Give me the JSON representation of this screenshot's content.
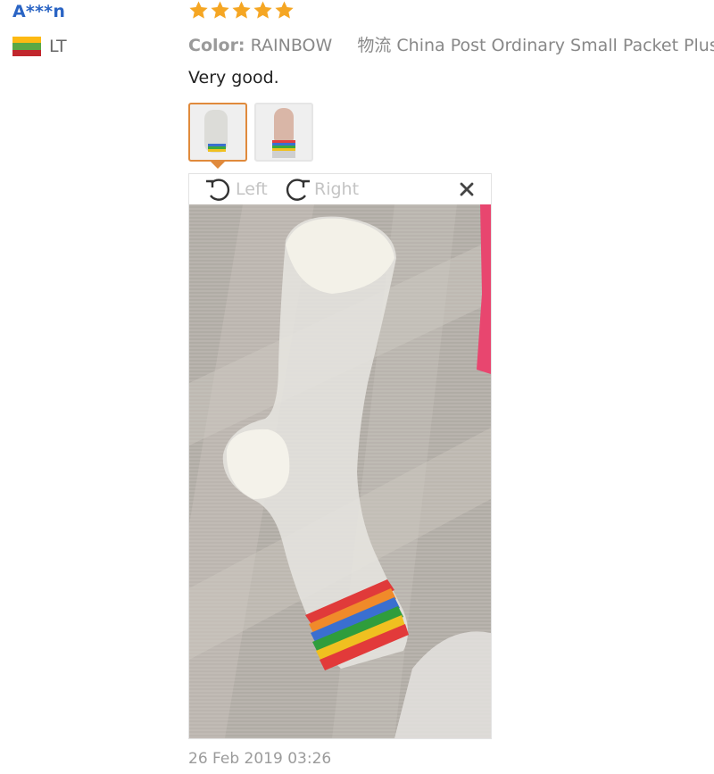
{
  "user": {
    "name": "A***n",
    "country_code": "LT",
    "flag_icon": "lithuania-flag-icon"
  },
  "review": {
    "rating": 5,
    "rating_max": 5,
    "star_color": "#f5a623",
    "color_label": "Color:",
    "color_value": "RAINBOW",
    "logistics_label": "物流",
    "logistics_value": "China Post Ordinary Small Packet Plus",
    "text": "Very good.",
    "date": "26 Feb 2019 03:26"
  },
  "viewer": {
    "rotate_left_label": "Left",
    "rotate_right_label": "Right",
    "rotate_left_icon": "rotate-left-icon",
    "rotate_right_icon": "rotate-right-icon",
    "close_icon": "close-icon",
    "selected_image": 1,
    "image_count": 2
  },
  "colors": {
    "username": "#2a64c4",
    "active_thumb": "#e08a3c",
    "muted_text": "#888888"
  }
}
